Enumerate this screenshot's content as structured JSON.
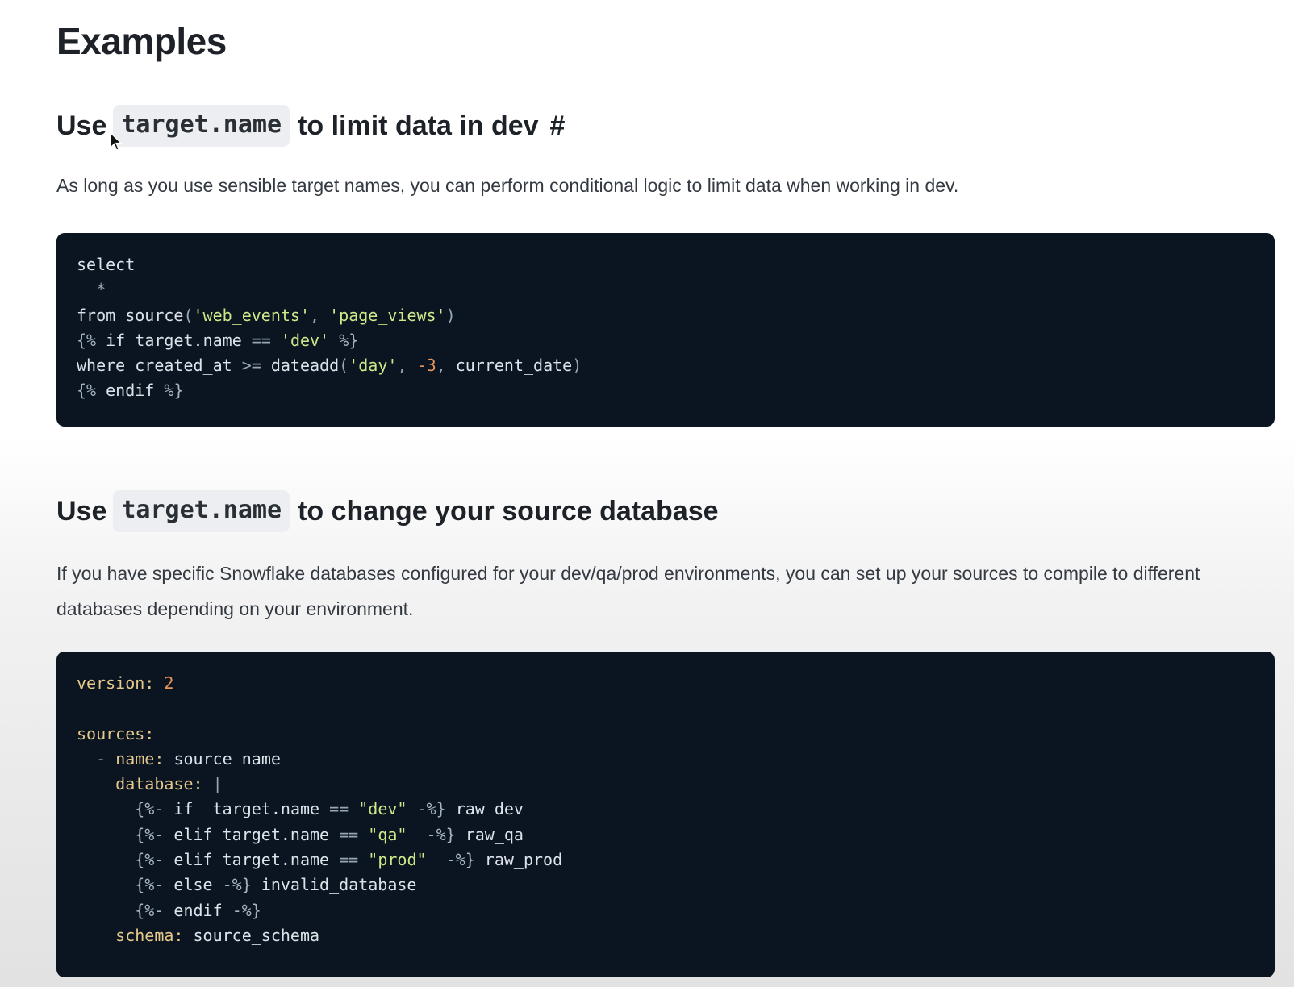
{
  "page": {
    "title": "Examples"
  },
  "section1": {
    "heading_prefix": "Use",
    "heading_code": "target.name",
    "heading_suffix": "to limit data in dev",
    "anchor": "#",
    "paragraph": "As long as you use sensible target names, you can perform conditional logic to limit data when working in dev.",
    "code_lines": [
      "select",
      "  *",
      "from source('web_events', 'page_views')",
      "{% if target.name == 'dev' %}",
      "where created_at >= dateadd('day', -3, current_date)",
      "{% endif %}"
    ]
  },
  "section2": {
    "heading_prefix": "Use",
    "heading_code": "target.name",
    "heading_suffix": "to change your source database",
    "paragraph": "If you have specific Snowflake databases configured for your dev/qa/prod environments, you can set up your sources to compile to different databases depending on your environment.",
    "code_lines": [
      "version: 2",
      "",
      "sources:",
      "  - name: source_name",
      "    database: |",
      "      {%- if  target.name == \"dev\" -%} raw_dev",
      "      {%- elif target.name == \"qa\"  -%} raw_qa",
      "      {%- elif target.name == \"prod\"  -%} raw_prod",
      "      {%- else -%} invalid_database",
      "      {%- endif -%}",
      "    schema: source_schema"
    ]
  },
  "icons": {
    "cursor": "mouse-pointer-icon"
  }
}
